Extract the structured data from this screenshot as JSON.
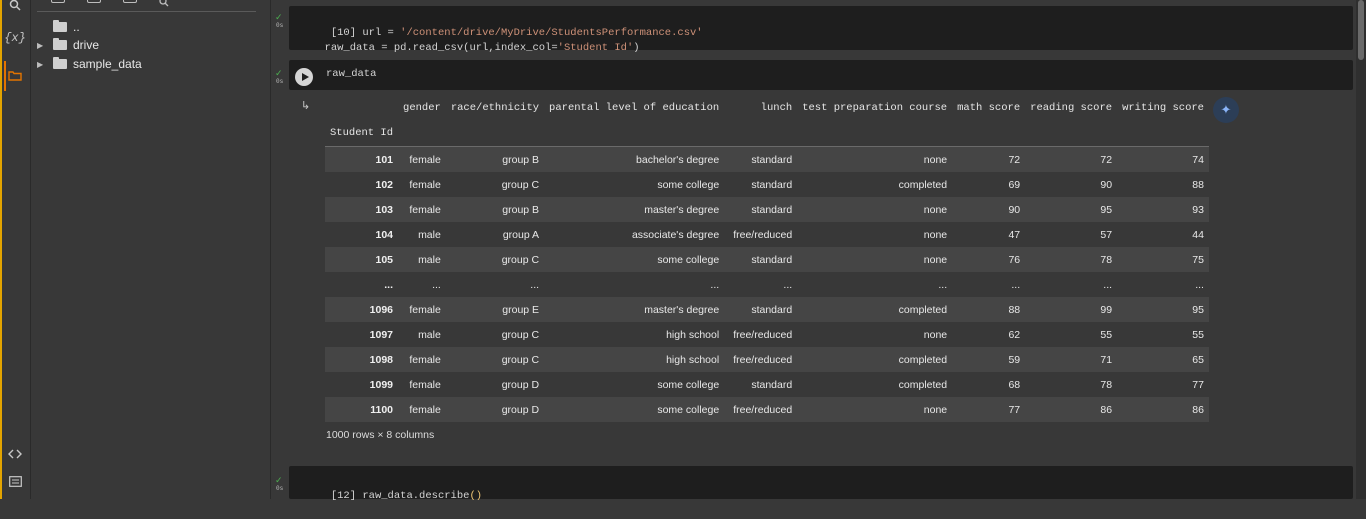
{
  "sidebar": {
    "variables_label": "{x}",
    "icons": [
      "search-icon",
      "variables-icon",
      "folder-icon",
      "code-snippets-icon",
      "terminal-icon"
    ]
  },
  "files": {
    "items": [
      {
        "label": ".."
      },
      {
        "label": "drive"
      },
      {
        "label": "sample_data"
      }
    ]
  },
  "cells": {
    "c1": {
      "count": "[10]",
      "time": "0s",
      "line1_pre": "url = ",
      "line1_str": "'/content/drive/MyDrive/StudentsPerformance.csv'",
      "line2_pre": "raw_data = pd.read_csv(url,index_col=",
      "line2_str": "'Student Id'",
      "line2_post": ")"
    },
    "c2": {
      "time": "0s",
      "code": "raw_data"
    },
    "c3": {
      "count": "[12]",
      "time": "0s",
      "code_pre": "raw_data.describe",
      "code_paren": "()"
    }
  },
  "dataframe": {
    "index_name": "Student Id",
    "columns": [
      "gender",
      "race/ethnicity",
      "parental level of education",
      "lunch",
      "test preparation course",
      "math score",
      "reading score",
      "writing score"
    ],
    "rows": [
      [
        "101",
        "female",
        "group B",
        "bachelor's degree",
        "standard",
        "none",
        "72",
        "72",
        "74"
      ],
      [
        "102",
        "female",
        "group C",
        "some college",
        "standard",
        "completed",
        "69",
        "90",
        "88"
      ],
      [
        "103",
        "female",
        "group B",
        "master's degree",
        "standard",
        "none",
        "90",
        "95",
        "93"
      ],
      [
        "104",
        "male",
        "group A",
        "associate's degree",
        "free/reduced",
        "none",
        "47",
        "57",
        "44"
      ],
      [
        "105",
        "male",
        "group C",
        "some college",
        "standard",
        "none",
        "76",
        "78",
        "75"
      ],
      [
        "...",
        "...",
        "...",
        "...",
        "...",
        "...",
        "...",
        "...",
        "..."
      ],
      [
        "1096",
        "female",
        "group E",
        "master's degree",
        "standard",
        "completed",
        "88",
        "99",
        "95"
      ],
      [
        "1097",
        "male",
        "group C",
        "high school",
        "free/reduced",
        "none",
        "62",
        "55",
        "55"
      ],
      [
        "1098",
        "female",
        "group C",
        "high school",
        "free/reduced",
        "completed",
        "59",
        "71",
        "65"
      ],
      [
        "1099",
        "female",
        "group D",
        "some college",
        "standard",
        "completed",
        "68",
        "78",
        "77"
      ],
      [
        "1100",
        "female",
        "group D",
        "some college",
        "free/reduced",
        "none",
        "77",
        "86",
        "86"
      ]
    ],
    "shape": "1000 rows × 8 columns"
  },
  "colors": {
    "accent": "#e37400",
    "string": "#ce9178",
    "success": "#4caf50"
  }
}
